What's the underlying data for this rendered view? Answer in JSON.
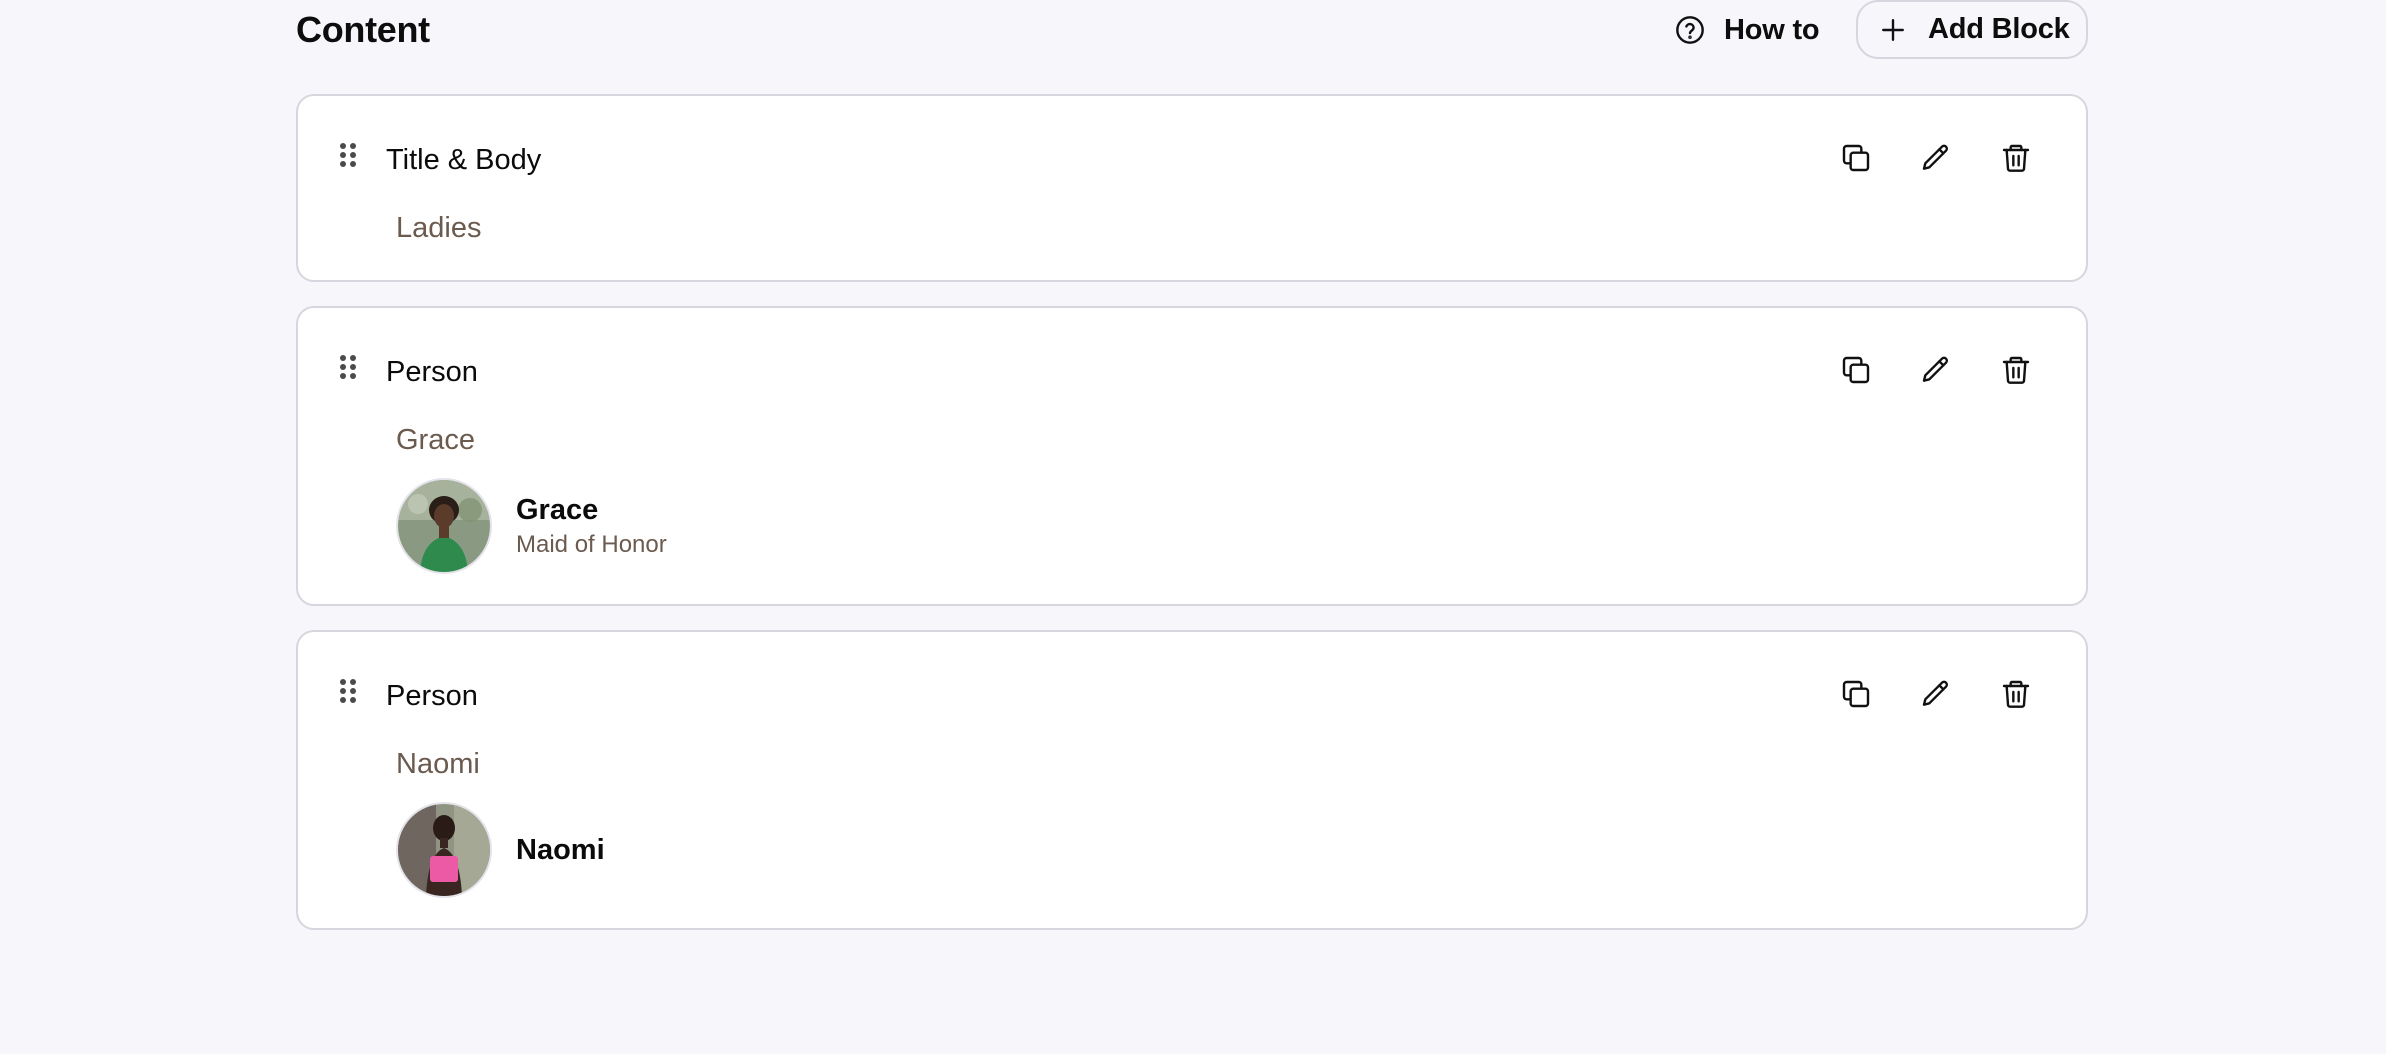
{
  "header": {
    "title": "Content",
    "how_to_label": "How to",
    "add_block_label": "Add Block"
  },
  "blocks": [
    {
      "type_label": "Title & Body",
      "subtitle": "Ladies"
    },
    {
      "type_label": "Person",
      "subtitle": "Grace",
      "person": {
        "name": "Grace",
        "role": "Maid of Honor"
      }
    },
    {
      "type_label": "Person",
      "subtitle": "Naomi",
      "person": {
        "name": "Naomi"
      }
    }
  ],
  "icons": {
    "how_to": "question-circle-icon",
    "add_block": "plus-icon",
    "drag": "drag-handle-icon",
    "duplicate": "copy-icon",
    "edit": "pencil-icon",
    "delete": "trash-icon"
  },
  "colors": {
    "page_background": "#f7f6fb",
    "card_background": "#ffffff",
    "border": "#d7d5de",
    "muted_text": "#6b5a4e"
  }
}
